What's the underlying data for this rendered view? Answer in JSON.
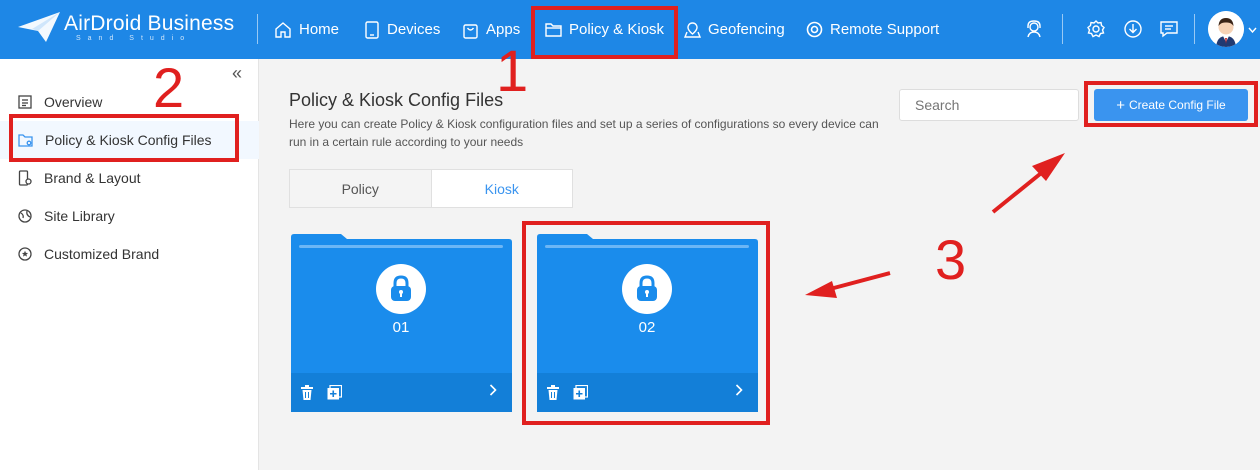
{
  "brand": {
    "name": "AirDroid Business",
    "sub": "Sand Studio"
  },
  "nav": [
    {
      "label": "Home",
      "icon": "home-icon"
    },
    {
      "label": "Devices",
      "icon": "tablet-icon"
    },
    {
      "label": "Apps",
      "icon": "bag-icon"
    },
    {
      "label": "Policy & Kiosk",
      "icon": "folder-icon"
    },
    {
      "label": "Geofencing",
      "icon": "map-pin-icon"
    },
    {
      "label": "Remote Support",
      "icon": "lifebuoy-icon"
    }
  ],
  "top_icons": [
    "support-agent-icon",
    "gear-icon",
    "download-icon",
    "message-icon"
  ],
  "sidebar": {
    "items": [
      {
        "label": "Overview",
        "icon": "list-icon"
      },
      {
        "label": "Policy & Kiosk Config Files",
        "icon": "config-folder-icon",
        "active": true
      },
      {
        "label": "Brand & Layout",
        "icon": "phone-gear-icon"
      },
      {
        "label": "Site Library",
        "icon": "globe-icon"
      },
      {
        "label": "Customized Brand",
        "icon": "star-circle-icon"
      }
    ]
  },
  "main": {
    "title": "Policy & Kiosk Config Files",
    "description": "Here you can create Policy & Kiosk configuration files and set up a series of configurations so every device can run in a certain rule according to your needs",
    "search_placeholder": "Search",
    "create_button": "Create Config File",
    "tabs": [
      {
        "label": "Policy"
      },
      {
        "label": "Kiosk",
        "active": true
      }
    ],
    "cards": [
      {
        "name": "01"
      },
      {
        "name": "02"
      }
    ]
  },
  "annotations": {
    "n1": "1",
    "n2": "2",
    "n3": "3"
  },
  "colors": {
    "topbar": "#1e87e6",
    "accent": "#3a94ef",
    "card": "#1a8cec",
    "annotation": "#e0201f"
  }
}
